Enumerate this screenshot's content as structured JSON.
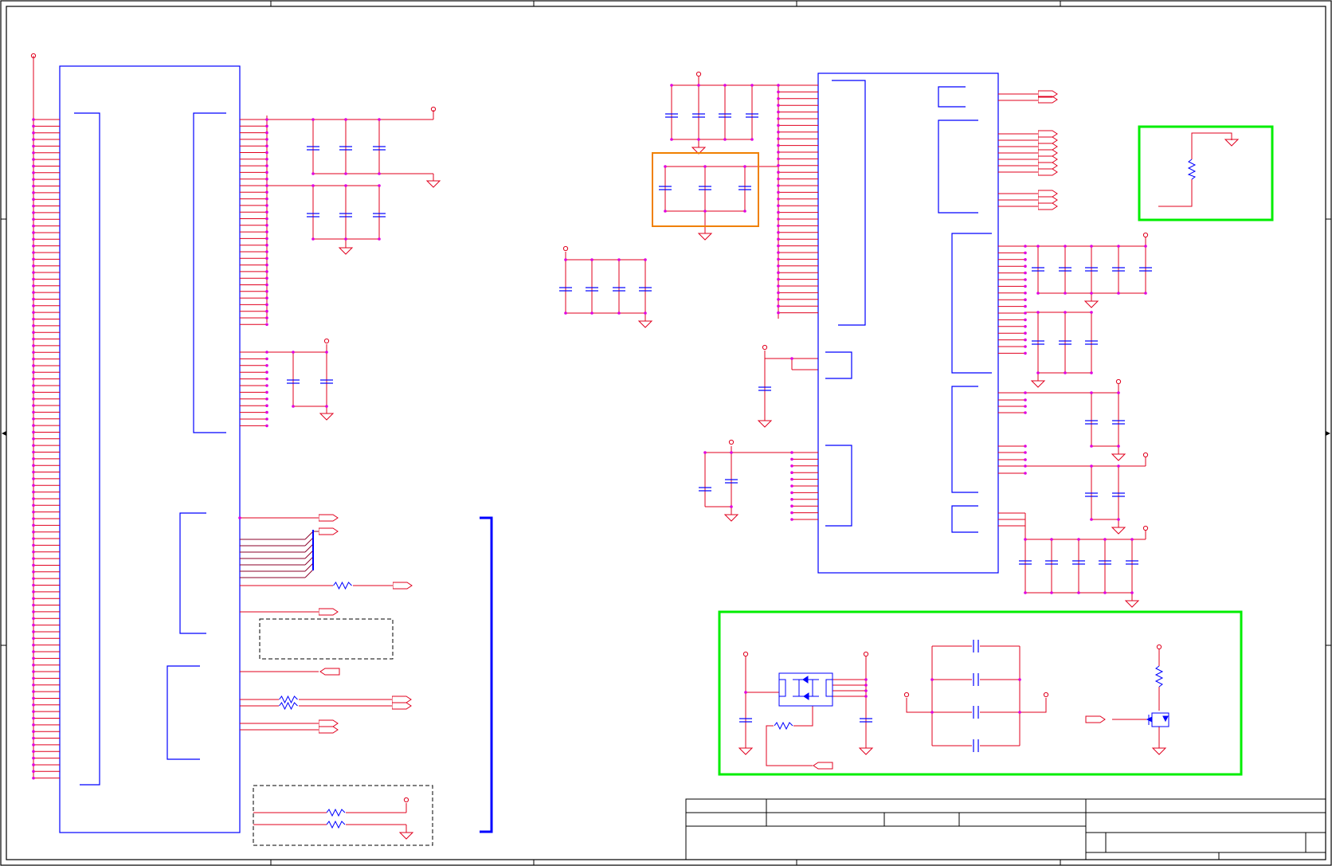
{
  "sheet": {
    "zone_columns": [
      "",
      "",
      "",
      "",
      ""
    ],
    "zone_rows": [
      "",
      "",
      "",
      ""
    ]
  },
  "title_block": {
    "company": "",
    "title": "",
    "size": "",
    "document_number": "",
    "revision": "",
    "date": "",
    "sheet_label": ""
  },
  "colors": {
    "wire": "#e0001e",
    "wire_dark": "#8b0029",
    "part_outline": "#0000ff",
    "junction": "#e000e0",
    "highlight_green": "#00ee00",
    "highlight_orange": "#f08000",
    "frame": "#000000",
    "dashed": "#000000"
  },
  "highlights": [
    {
      "id": "decoupling-group",
      "color": "orange"
    },
    {
      "id": "pullup-group",
      "color": "green"
    },
    {
      "id": "power-switch-group",
      "color": "green"
    }
  ],
  "icons": [
    "power-port-icon",
    "ground-icon",
    "capacitor-icon",
    "resistor-icon",
    "mosfet-icon",
    "offpage-connector-icon",
    "net-junction-icon"
  ]
}
